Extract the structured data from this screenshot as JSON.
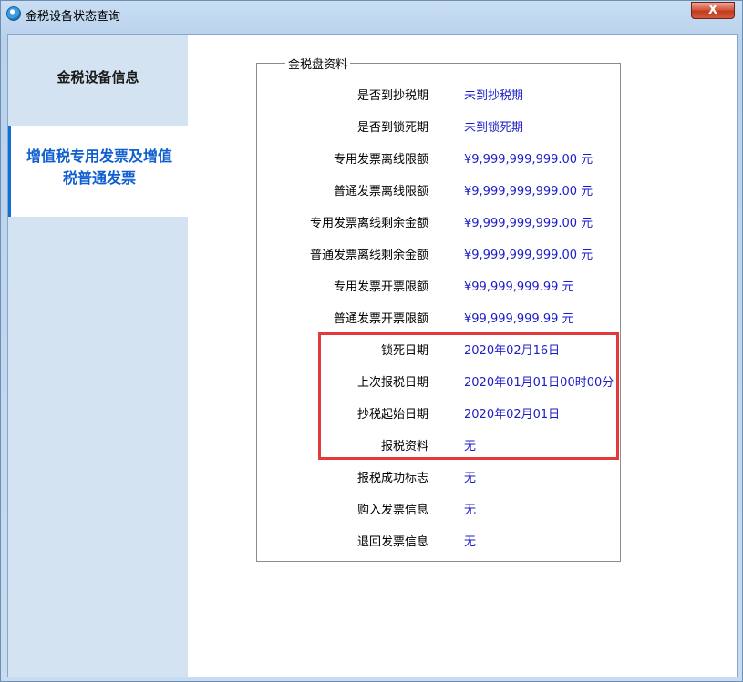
{
  "window": {
    "title": "金税设备状态查询",
    "close_label": "X"
  },
  "sidebar": {
    "items": [
      {
        "label": "金税设备信息",
        "active": false
      },
      {
        "label": "增值税专用发票及增值税普通发票",
        "active": true
      }
    ]
  },
  "group": {
    "legend": "金税盘资料",
    "rows": [
      {
        "label": "是否到抄税期",
        "value": "未到抄税期"
      },
      {
        "label": "是否到锁死期",
        "value": "未到锁死期"
      },
      {
        "label": "专用发票离线限额",
        "value": "¥9,999,999,999.00 元"
      },
      {
        "label": "普通发票离线限额",
        "value": "¥9,999,999,999.00 元"
      },
      {
        "label": "专用发票离线剩余金额",
        "value": "¥9,999,999,999.00 元"
      },
      {
        "label": "普通发票离线剩余金额",
        "value": "¥9,999,999,999.00 元"
      },
      {
        "label": "专用发票开票限额",
        "value": "¥99,999,999.99 元"
      },
      {
        "label": "普通发票开票限额",
        "value": "¥99,999,999.99 元"
      },
      {
        "label": "锁死日期",
        "value": "2020年02月16日"
      },
      {
        "label": "上次报税日期",
        "value": "2020年01月01日00时00分"
      },
      {
        "label": "抄税起始日期",
        "value": "2020年02月01日"
      },
      {
        "label": "报税资料",
        "value": "无"
      },
      {
        "label": "报税成功标志",
        "value": "无"
      },
      {
        "label": "购入发票信息",
        "value": "无"
      },
      {
        "label": "退回发票信息",
        "value": "无"
      }
    ]
  },
  "colors": {
    "value_text": "#1c1cc8",
    "active_tab_text": "#0f5fd0",
    "highlight_border": "#e2393a"
  }
}
